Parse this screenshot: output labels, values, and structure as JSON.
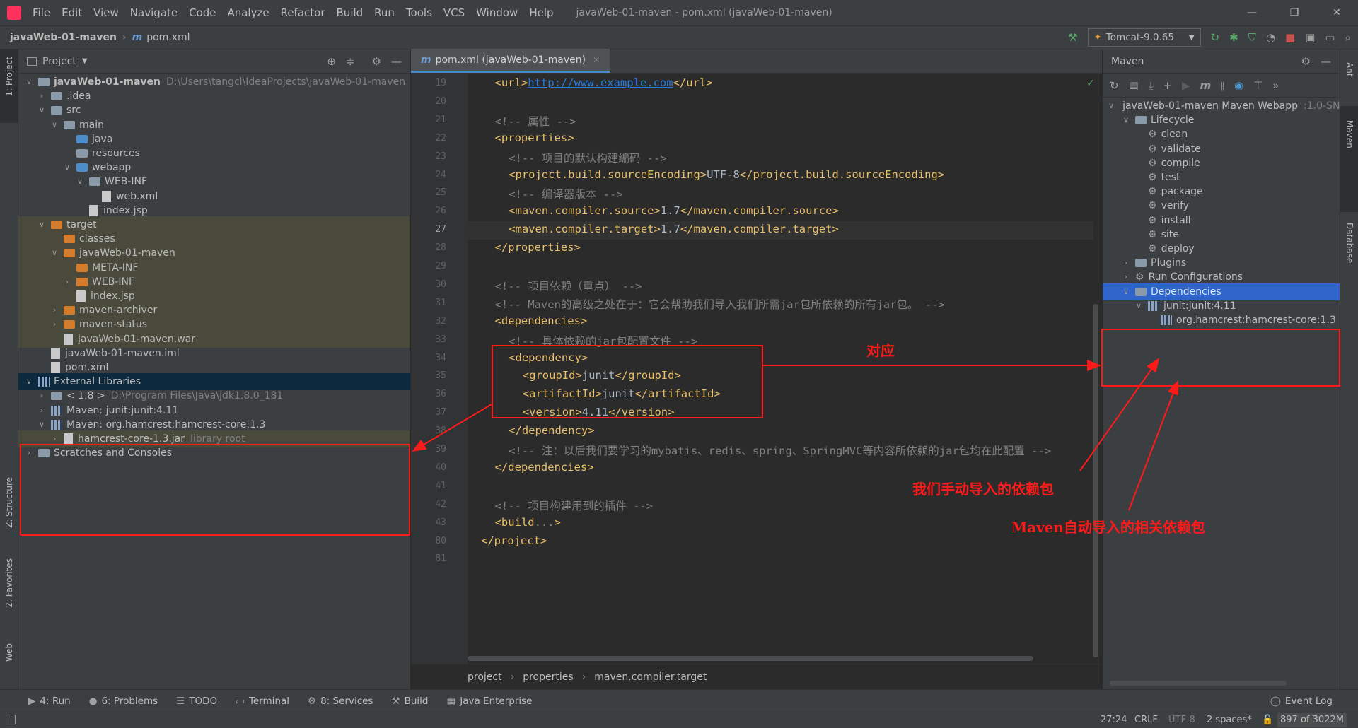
{
  "window": {
    "title": "javaWeb-01-maven - pom.xml (javaWeb-01-maven)",
    "controls": [
      "—",
      "❐",
      "✕"
    ]
  },
  "menu": [
    "File",
    "Edit",
    "View",
    "Navigate",
    "Code",
    "Analyze",
    "Refactor",
    "Build",
    "Run",
    "Tools",
    "VCS",
    "Window",
    "Help"
  ],
  "navbar": {
    "project": "javaWeb-01-maven",
    "file": "pom.xml",
    "run_config": "Tomcat-9.0.65"
  },
  "left_strip": [
    "1: Project",
    "Z: Structure",
    "2: Favorites",
    "Web"
  ],
  "right_strip": [
    "Ant",
    "Maven",
    "Database"
  ],
  "project_panel": {
    "title": "Project",
    "tree": [
      {
        "indent": 0,
        "chev": "v",
        "icon": "folder",
        "label": "javaWeb-01-maven",
        "bold": true,
        "dim": "D:\\Users\\tangcl\\IdeaProjects\\javaWeb-01-maven"
      },
      {
        "indent": 1,
        "chev": ">",
        "icon": "folder",
        "label": ".idea"
      },
      {
        "indent": 1,
        "chev": "v",
        "icon": "folder",
        "label": "src"
      },
      {
        "indent": 2,
        "chev": "v",
        "icon": "folder",
        "label": "main"
      },
      {
        "indent": 3,
        "chev": "",
        "icon": "folder-blue",
        "label": "java"
      },
      {
        "indent": 3,
        "chev": "",
        "icon": "folder",
        "label": "resources"
      },
      {
        "indent": 3,
        "chev": "v",
        "icon": "folder-blue",
        "label": "webapp"
      },
      {
        "indent": 4,
        "chev": "v",
        "icon": "folder",
        "label": "WEB-INF"
      },
      {
        "indent": 5,
        "chev": "",
        "icon": "file",
        "label": "web.xml"
      },
      {
        "indent": 4,
        "chev": "",
        "icon": "file",
        "label": "index.jsp"
      },
      {
        "indent": 1,
        "chev": "v",
        "icon": "folder-orange",
        "label": "target",
        "target": true
      },
      {
        "indent": 2,
        "chev": "",
        "icon": "folder-orange",
        "label": "classes",
        "target": true
      },
      {
        "indent": 2,
        "chev": "v",
        "icon": "folder-orange",
        "label": "javaWeb-01-maven",
        "target": true
      },
      {
        "indent": 3,
        "chev": "",
        "icon": "folder-orange",
        "label": "META-INF",
        "target": true
      },
      {
        "indent": 3,
        "chev": ">",
        "icon": "folder-orange",
        "label": "WEB-INF",
        "target": true
      },
      {
        "indent": 3,
        "chev": "",
        "icon": "file",
        "label": "index.jsp",
        "target": true
      },
      {
        "indent": 2,
        "chev": ">",
        "icon": "folder-orange",
        "label": "maven-archiver",
        "target": true
      },
      {
        "indent": 2,
        "chev": ">",
        "icon": "folder-orange",
        "label": "maven-status",
        "target": true
      },
      {
        "indent": 2,
        "chev": "",
        "icon": "file",
        "label": "javaWeb-01-maven.war",
        "target": true
      },
      {
        "indent": 1,
        "chev": "",
        "icon": "file",
        "label": "javaWeb-01-maven.iml"
      },
      {
        "indent": 1,
        "chev": "",
        "icon": "file",
        "label": "pom.xml"
      },
      {
        "indent": 0,
        "chev": "v",
        "icon": "lib",
        "label": "External Libraries",
        "selected": true
      },
      {
        "indent": 1,
        "chev": ">",
        "icon": "folder",
        "label": "< 1.8 >",
        "dim": "D:\\Program Files\\Java\\jdk1.8.0_181"
      },
      {
        "indent": 1,
        "chev": ">",
        "icon": "lib",
        "label": "Maven: junit:junit:4.11"
      },
      {
        "indent": 1,
        "chev": "v",
        "icon": "lib",
        "label": "Maven: org.hamcrest:hamcrest-core:1.3"
      },
      {
        "indent": 2,
        "chev": ">",
        "icon": "file",
        "label": "hamcrest-core-1.3.jar",
        "dim": "library root",
        "target": true
      },
      {
        "indent": 0,
        "chev": ">",
        "icon": "folder",
        "label": "Scratches and Consoles"
      }
    ]
  },
  "editor": {
    "tab": "pom.xml (javaWeb-01-maven)",
    "line_numbers": [
      "19",
      "20",
      "21",
      "22",
      "23",
      "24",
      "25",
      "26",
      "27",
      "28",
      "29",
      "30",
      "31",
      "32",
      "33",
      "34",
      "35",
      "36",
      "37",
      "38",
      "39",
      "40",
      "41",
      "42",
      "43",
      "80",
      "81"
    ],
    "lines": [
      {
        "indent": 2,
        "parts": [
          [
            "tag",
            "<url>"
          ],
          [
            "link",
            "http://www.example.com"
          ],
          [
            "tag",
            "</url>"
          ]
        ]
      },
      {
        "indent": 0,
        "parts": []
      },
      {
        "indent": 2,
        "parts": [
          [
            "cmt",
            "<!-- 属性 -->"
          ]
        ]
      },
      {
        "indent": 2,
        "parts": [
          [
            "tag",
            "<properties>"
          ]
        ]
      },
      {
        "indent": 4,
        "parts": [
          [
            "cmt",
            "<!-- 项目的默认构建编码 -->"
          ]
        ]
      },
      {
        "indent": 4,
        "parts": [
          [
            "tag",
            "<project.build.sourceEncoding>"
          ],
          [
            "txt",
            "UTF-8"
          ],
          [
            "tag",
            "</project.build.sourceEncoding>"
          ]
        ]
      },
      {
        "indent": 4,
        "parts": [
          [
            "cmt",
            "<!-- 编译器版本 -->"
          ]
        ]
      },
      {
        "indent": 4,
        "parts": [
          [
            "tag",
            "<maven.compiler.source>"
          ],
          [
            "txt",
            "1.7"
          ],
          [
            "tag",
            "</maven.compiler.source>"
          ]
        ]
      },
      {
        "indent": 4,
        "parts": [
          [
            "tag",
            "<maven.compiler.target>"
          ],
          [
            "txt",
            "1.7"
          ],
          [
            "tag",
            "</maven.compiler.target>"
          ]
        ],
        "current": true
      },
      {
        "indent": 2,
        "parts": [
          [
            "tag",
            "</properties>"
          ]
        ]
      },
      {
        "indent": 0,
        "parts": []
      },
      {
        "indent": 2,
        "parts": [
          [
            "cmt",
            "<!-- 项目依赖（重点） -->"
          ]
        ]
      },
      {
        "indent": 2,
        "parts": [
          [
            "cmt",
            "<!-- Maven的高级之处在于：它会帮助我们导入我们所需jar包所依赖的所有jar包。 -->"
          ]
        ]
      },
      {
        "indent": 2,
        "parts": [
          [
            "tag",
            "<dependencies>"
          ]
        ]
      },
      {
        "indent": 4,
        "parts": [
          [
            "cmt",
            "<!-- 具体依赖的jar包配置文件 -->"
          ]
        ]
      },
      {
        "indent": 4,
        "parts": [
          [
            "tag",
            "<dependency>"
          ]
        ]
      },
      {
        "indent": 6,
        "parts": [
          [
            "tag",
            "<groupId>"
          ],
          [
            "txt",
            "junit"
          ],
          [
            "tag",
            "</groupId>"
          ]
        ]
      },
      {
        "indent": 6,
        "parts": [
          [
            "tag",
            "<artifactId>"
          ],
          [
            "txt",
            "junit"
          ],
          [
            "tag",
            "</artifactId>"
          ]
        ]
      },
      {
        "indent": 6,
        "parts": [
          [
            "tag",
            "<version>"
          ],
          [
            "txt",
            "4.11"
          ],
          [
            "tag",
            "</version>"
          ]
        ]
      },
      {
        "indent": 4,
        "parts": [
          [
            "tag",
            "</dependency>"
          ]
        ]
      },
      {
        "indent": 4,
        "parts": [
          [
            "cmt",
            "<!-- 注：以后我们要学习的mybatis、redis、spring、SpringMVC等内容所依赖的jar包均在此配置 -->"
          ]
        ]
      },
      {
        "indent": 2,
        "parts": [
          [
            "tag",
            "</dependencies>"
          ]
        ]
      },
      {
        "indent": 0,
        "parts": []
      },
      {
        "indent": 2,
        "parts": [
          [
            "cmt",
            "<!-- 项目构建用到的插件 -->"
          ]
        ]
      },
      {
        "indent": 2,
        "parts": [
          [
            "tag",
            "<build"
          ],
          [
            "cmt",
            "..."
          ],
          [
            "tag",
            ">"
          ]
        ]
      },
      {
        "indent": 0,
        "parts": [
          [
            "tag",
            "</project>"
          ]
        ]
      },
      {
        "indent": 0,
        "parts": []
      }
    ],
    "breadcrumb": [
      "project",
      "properties",
      "maven.compiler.target"
    ]
  },
  "maven": {
    "title": "Maven",
    "tree": [
      {
        "indent": 0,
        "chev": "v",
        "icon": "maven",
        "label": "javaWeb-01-maven Maven Webapp",
        "dim": ":1.0-SN"
      },
      {
        "indent": 1,
        "chev": "v",
        "icon": "folder",
        "label": "Lifecycle"
      },
      {
        "indent": 2,
        "chev": "",
        "icon": "gear",
        "label": "clean"
      },
      {
        "indent": 2,
        "chev": "",
        "icon": "gear",
        "label": "validate"
      },
      {
        "indent": 2,
        "chev": "",
        "icon": "gear",
        "label": "compile"
      },
      {
        "indent": 2,
        "chev": "",
        "icon": "gear",
        "label": "test"
      },
      {
        "indent": 2,
        "chev": "",
        "icon": "gear",
        "label": "package"
      },
      {
        "indent": 2,
        "chev": "",
        "icon": "gear",
        "label": "verify"
      },
      {
        "indent": 2,
        "chev": "",
        "icon": "gear",
        "label": "install"
      },
      {
        "indent": 2,
        "chev": "",
        "icon": "gear",
        "label": "site"
      },
      {
        "indent": 2,
        "chev": "",
        "icon": "gear",
        "label": "deploy"
      },
      {
        "indent": 1,
        "chev": ">",
        "icon": "folder",
        "label": "Plugins"
      },
      {
        "indent": 1,
        "chev": ">",
        "icon": "gear",
        "label": "Run Configurations"
      },
      {
        "indent": 1,
        "chev": "v",
        "icon": "folder",
        "label": "Dependencies",
        "selected": true
      },
      {
        "indent": 2,
        "chev": "v",
        "icon": "lib",
        "label": "junit:junit:4.11"
      },
      {
        "indent": 3,
        "chev": "",
        "icon": "lib",
        "label": "org.hamcrest:hamcrest-core:1.3"
      }
    ]
  },
  "annotations": {
    "correspond": "对应",
    "manual": "我们手动导入的依赖包",
    "auto": "Maven自动导入的相关依赖包"
  },
  "tool_windows": [
    "4: Run",
    "6: Problems",
    "TODO",
    "Terminal",
    "8: Services",
    "Build",
    "Java Enterprise"
  ],
  "event_log": "Event Log",
  "status": {
    "position": "27:24",
    "line_sep": "CRLF",
    "encoding": "UTF-8",
    "indent": "2 spaces*",
    "memory": "897 of 3022M"
  },
  "colors": {
    "accent": "#4a88c7",
    "annotation": "#ff1a1a",
    "selected": "#0d293e"
  }
}
